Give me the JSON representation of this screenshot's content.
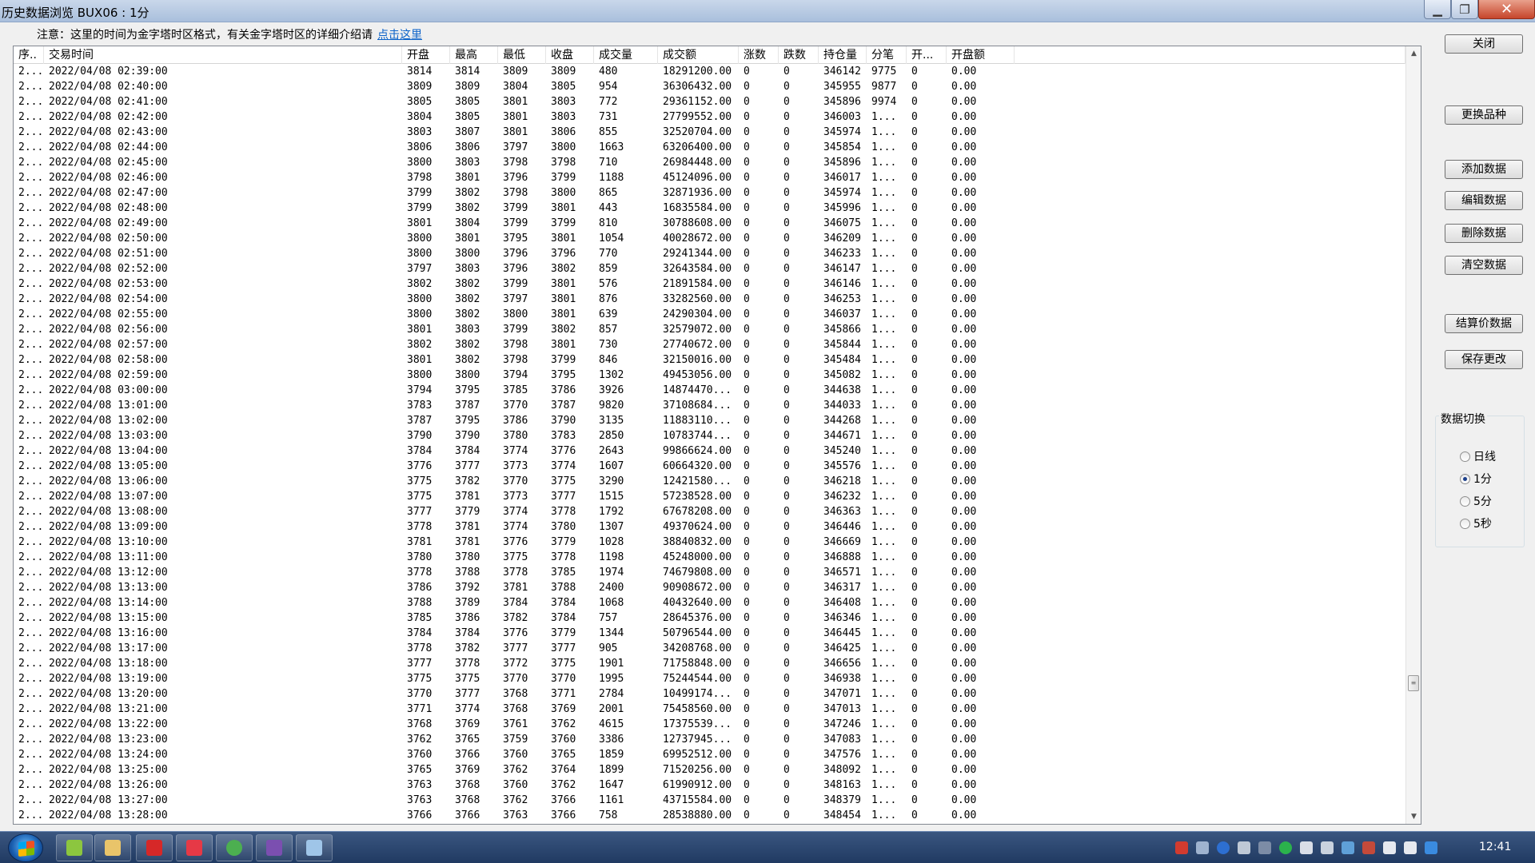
{
  "window": {
    "title": "历史数据浏览 BUX06 : 1分"
  },
  "notice": {
    "text": "注意：这里的时间为金字塔时区格式，有关金字塔时区的详细介绍请",
    "link": "点击这里"
  },
  "table": {
    "headers": [
      "序..",
      "交易时间",
      "开盘",
      "最高",
      "最低",
      "收盘",
      "成交量",
      "成交额",
      "涨数",
      "跌数",
      "持仓量",
      "分笔",
      "开...",
      "开盘额"
    ],
    "rows": [
      [
        "2...",
        "2022/04/08 02:39:00",
        "3814",
        "3814",
        "3809",
        "3809",
        "480",
        "18291200.00",
        "0",
        "0",
        "346142",
        "9775",
        "0",
        "0.00"
      ],
      [
        "2...",
        "2022/04/08 02:40:00",
        "3809",
        "3809",
        "3804",
        "3805",
        "954",
        "36306432.00",
        "0",
        "0",
        "345955",
        "9877",
        "0",
        "0.00"
      ],
      [
        "2...",
        "2022/04/08 02:41:00",
        "3805",
        "3805",
        "3801",
        "3803",
        "772",
        "29361152.00",
        "0",
        "0",
        "345896",
        "9974",
        "0",
        "0.00"
      ],
      [
        "2...",
        "2022/04/08 02:42:00",
        "3804",
        "3805",
        "3801",
        "3803",
        "731",
        "27799552.00",
        "0",
        "0",
        "346003",
        "1...",
        "0",
        "0.00"
      ],
      [
        "2...",
        "2022/04/08 02:43:00",
        "3803",
        "3807",
        "3801",
        "3806",
        "855",
        "32520704.00",
        "0",
        "0",
        "345974",
        "1...",
        "0",
        "0.00"
      ],
      [
        "2...",
        "2022/04/08 02:44:00",
        "3806",
        "3806",
        "3797",
        "3800",
        "1663",
        "63206400.00",
        "0",
        "0",
        "345854",
        "1...",
        "0",
        "0.00"
      ],
      [
        "2...",
        "2022/04/08 02:45:00",
        "3800",
        "3803",
        "3798",
        "3798",
        "710",
        "26984448.00",
        "0",
        "0",
        "345896",
        "1...",
        "0",
        "0.00"
      ],
      [
        "2...",
        "2022/04/08 02:46:00",
        "3798",
        "3801",
        "3796",
        "3799",
        "1188",
        "45124096.00",
        "0",
        "0",
        "346017",
        "1...",
        "0",
        "0.00"
      ],
      [
        "2...",
        "2022/04/08 02:47:00",
        "3799",
        "3802",
        "3798",
        "3800",
        "865",
        "32871936.00",
        "0",
        "0",
        "345974",
        "1...",
        "0",
        "0.00"
      ],
      [
        "2...",
        "2022/04/08 02:48:00",
        "3799",
        "3802",
        "3799",
        "3801",
        "443",
        "16835584.00",
        "0",
        "0",
        "345996",
        "1...",
        "0",
        "0.00"
      ],
      [
        "2...",
        "2022/04/08 02:49:00",
        "3801",
        "3804",
        "3799",
        "3799",
        "810",
        "30788608.00",
        "0",
        "0",
        "346075",
        "1...",
        "0",
        "0.00"
      ],
      [
        "2...",
        "2022/04/08 02:50:00",
        "3800",
        "3801",
        "3795",
        "3801",
        "1054",
        "40028672.00",
        "0",
        "0",
        "346209",
        "1...",
        "0",
        "0.00"
      ],
      [
        "2...",
        "2022/04/08 02:51:00",
        "3800",
        "3800",
        "3796",
        "3796",
        "770",
        "29241344.00",
        "0",
        "0",
        "346233",
        "1...",
        "0",
        "0.00"
      ],
      [
        "2...",
        "2022/04/08 02:52:00",
        "3797",
        "3803",
        "3796",
        "3802",
        "859",
        "32643584.00",
        "0",
        "0",
        "346147",
        "1...",
        "0",
        "0.00"
      ],
      [
        "2...",
        "2022/04/08 02:53:00",
        "3802",
        "3802",
        "3799",
        "3801",
        "576",
        "21891584.00",
        "0",
        "0",
        "346146",
        "1...",
        "0",
        "0.00"
      ],
      [
        "2...",
        "2022/04/08 02:54:00",
        "3800",
        "3802",
        "3797",
        "3801",
        "876",
        "33282560.00",
        "0",
        "0",
        "346253",
        "1...",
        "0",
        "0.00"
      ],
      [
        "2...",
        "2022/04/08 02:55:00",
        "3800",
        "3802",
        "3800",
        "3801",
        "639",
        "24290304.00",
        "0",
        "0",
        "346037",
        "1...",
        "0",
        "0.00"
      ],
      [
        "2...",
        "2022/04/08 02:56:00",
        "3801",
        "3803",
        "3799",
        "3802",
        "857",
        "32579072.00",
        "0",
        "0",
        "345866",
        "1...",
        "0",
        "0.00"
      ],
      [
        "2...",
        "2022/04/08 02:57:00",
        "3802",
        "3802",
        "3798",
        "3801",
        "730",
        "27740672.00",
        "0",
        "0",
        "345844",
        "1...",
        "0",
        "0.00"
      ],
      [
        "2...",
        "2022/04/08 02:58:00",
        "3801",
        "3802",
        "3798",
        "3799",
        "846",
        "32150016.00",
        "0",
        "0",
        "345484",
        "1...",
        "0",
        "0.00"
      ],
      [
        "2...",
        "2022/04/08 02:59:00",
        "3800",
        "3800",
        "3794",
        "3795",
        "1302",
        "49453056.00",
        "0",
        "0",
        "345082",
        "1...",
        "0",
        "0.00"
      ],
      [
        "2...",
        "2022/04/08 03:00:00",
        "3794",
        "3795",
        "3785",
        "3786",
        "3926",
        "14874470...",
        "0",
        "0",
        "344638",
        "1...",
        "0",
        "0.00"
      ],
      [
        "2...",
        "2022/04/08 13:01:00",
        "3783",
        "3787",
        "3770",
        "3787",
        "9820",
        "37108684...",
        "0",
        "0",
        "344033",
        "1...",
        "0",
        "0.00"
      ],
      [
        "2...",
        "2022/04/08 13:02:00",
        "3787",
        "3795",
        "3786",
        "3790",
        "3135",
        "11883110...",
        "0",
        "0",
        "344268",
        "1...",
        "0",
        "0.00"
      ],
      [
        "2...",
        "2022/04/08 13:03:00",
        "3790",
        "3790",
        "3780",
        "3783",
        "2850",
        "10783744...",
        "0",
        "0",
        "344671",
        "1...",
        "0",
        "0.00"
      ],
      [
        "2...",
        "2022/04/08 13:04:00",
        "3784",
        "3784",
        "3774",
        "3776",
        "2643",
        "99866624.00",
        "0",
        "0",
        "345240",
        "1...",
        "0",
        "0.00"
      ],
      [
        "2...",
        "2022/04/08 13:05:00",
        "3776",
        "3777",
        "3773",
        "3774",
        "1607",
        "60664320.00",
        "0",
        "0",
        "345576",
        "1...",
        "0",
        "0.00"
      ],
      [
        "2...",
        "2022/04/08 13:06:00",
        "3775",
        "3782",
        "3770",
        "3775",
        "3290",
        "12421580...",
        "0",
        "0",
        "346218",
        "1...",
        "0",
        "0.00"
      ],
      [
        "2...",
        "2022/04/08 13:07:00",
        "3775",
        "3781",
        "3773",
        "3777",
        "1515",
        "57238528.00",
        "0",
        "0",
        "346232",
        "1...",
        "0",
        "0.00"
      ],
      [
        "2...",
        "2022/04/08 13:08:00",
        "3777",
        "3779",
        "3774",
        "3778",
        "1792",
        "67678208.00",
        "0",
        "0",
        "346363",
        "1...",
        "0",
        "0.00"
      ],
      [
        "2...",
        "2022/04/08 13:09:00",
        "3778",
        "3781",
        "3774",
        "3780",
        "1307",
        "49370624.00",
        "0",
        "0",
        "346446",
        "1...",
        "0",
        "0.00"
      ],
      [
        "2...",
        "2022/04/08 13:10:00",
        "3781",
        "3781",
        "3776",
        "3779",
        "1028",
        "38840832.00",
        "0",
        "0",
        "346669",
        "1...",
        "0",
        "0.00"
      ],
      [
        "2...",
        "2022/04/08 13:11:00",
        "3780",
        "3780",
        "3775",
        "3778",
        "1198",
        "45248000.00",
        "0",
        "0",
        "346888",
        "1...",
        "0",
        "0.00"
      ],
      [
        "2...",
        "2022/04/08 13:12:00",
        "3778",
        "3788",
        "3778",
        "3785",
        "1974",
        "74679808.00",
        "0",
        "0",
        "346571",
        "1...",
        "0",
        "0.00"
      ],
      [
        "2...",
        "2022/04/08 13:13:00",
        "3786",
        "3792",
        "3781",
        "3788",
        "2400",
        "90908672.00",
        "0",
        "0",
        "346317",
        "1...",
        "0",
        "0.00"
      ],
      [
        "2...",
        "2022/04/08 13:14:00",
        "3788",
        "3789",
        "3784",
        "3784",
        "1068",
        "40432640.00",
        "0",
        "0",
        "346408",
        "1...",
        "0",
        "0.00"
      ],
      [
        "2...",
        "2022/04/08 13:15:00",
        "3785",
        "3786",
        "3782",
        "3784",
        "757",
        "28645376.00",
        "0",
        "0",
        "346346",
        "1...",
        "0",
        "0.00"
      ],
      [
        "2...",
        "2022/04/08 13:16:00",
        "3784",
        "3784",
        "3776",
        "3779",
        "1344",
        "50796544.00",
        "0",
        "0",
        "346445",
        "1...",
        "0",
        "0.00"
      ],
      [
        "2...",
        "2022/04/08 13:17:00",
        "3778",
        "3782",
        "3777",
        "3777",
        "905",
        "34208768.00",
        "0",
        "0",
        "346425",
        "1...",
        "0",
        "0.00"
      ],
      [
        "2...",
        "2022/04/08 13:18:00",
        "3777",
        "3778",
        "3772",
        "3775",
        "1901",
        "71758848.00",
        "0",
        "0",
        "346656",
        "1...",
        "0",
        "0.00"
      ],
      [
        "2...",
        "2022/04/08 13:19:00",
        "3775",
        "3775",
        "3770",
        "3770",
        "1995",
        "75244544.00",
        "0",
        "0",
        "346938",
        "1...",
        "0",
        "0.00"
      ],
      [
        "2...",
        "2022/04/08 13:20:00",
        "3770",
        "3777",
        "3768",
        "3771",
        "2784",
        "10499174...",
        "0",
        "0",
        "347071",
        "1...",
        "0",
        "0.00"
      ],
      [
        "2...",
        "2022/04/08 13:21:00",
        "3771",
        "3774",
        "3768",
        "3769",
        "2001",
        "75458560.00",
        "0",
        "0",
        "347013",
        "1...",
        "0",
        "0.00"
      ],
      [
        "2...",
        "2022/04/08 13:22:00",
        "3768",
        "3769",
        "3761",
        "3762",
        "4615",
        "17375539...",
        "0",
        "0",
        "347246",
        "1...",
        "0",
        "0.00"
      ],
      [
        "2...",
        "2022/04/08 13:23:00",
        "3762",
        "3765",
        "3759",
        "3760",
        "3386",
        "12737945...",
        "0",
        "0",
        "347083",
        "1...",
        "0",
        "0.00"
      ],
      [
        "2...",
        "2022/04/08 13:24:00",
        "3760",
        "3766",
        "3760",
        "3765",
        "1859",
        "69952512.00",
        "0",
        "0",
        "347576",
        "1...",
        "0",
        "0.00"
      ],
      [
        "2...",
        "2022/04/08 13:25:00",
        "3765",
        "3769",
        "3762",
        "3764",
        "1899",
        "71520256.00",
        "0",
        "0",
        "348092",
        "1...",
        "0",
        "0.00"
      ],
      [
        "2...",
        "2022/04/08 13:26:00",
        "3763",
        "3768",
        "3760",
        "3762",
        "1647",
        "61990912.00",
        "0",
        "0",
        "348163",
        "1...",
        "0",
        "0.00"
      ],
      [
        "2...",
        "2022/04/08 13:27:00",
        "3763",
        "3768",
        "3762",
        "3766",
        "1161",
        "43715584.00",
        "0",
        "0",
        "348379",
        "1...",
        "0",
        "0.00"
      ],
      [
        "2...",
        "2022/04/08 13:28:00",
        "3766",
        "3766",
        "3763",
        "3766",
        "758",
        "28538880.00",
        "0",
        "0",
        "348454",
        "1...",
        "0",
        "0.00"
      ]
    ]
  },
  "buttons": {
    "close": "关闭",
    "change_symbol": "更换品种",
    "add": "添加数据",
    "edit": "编辑数据",
    "delete": "删除数据",
    "clear": "清空数据",
    "settle": "结算价数据",
    "save": "保存更改"
  },
  "data_switch": {
    "title": "数据切换",
    "options": [
      "日线",
      "1分",
      "5分",
      "5秒"
    ],
    "selected": "1分"
  },
  "taskbar": {
    "clock": "12:41",
    "apps": [
      "notepad-icon",
      "folder-icon",
      "drawing-app-icon",
      "weibo-icon",
      "chrome-icon",
      "visual-studio-icon",
      "window-icon"
    ]
  }
}
